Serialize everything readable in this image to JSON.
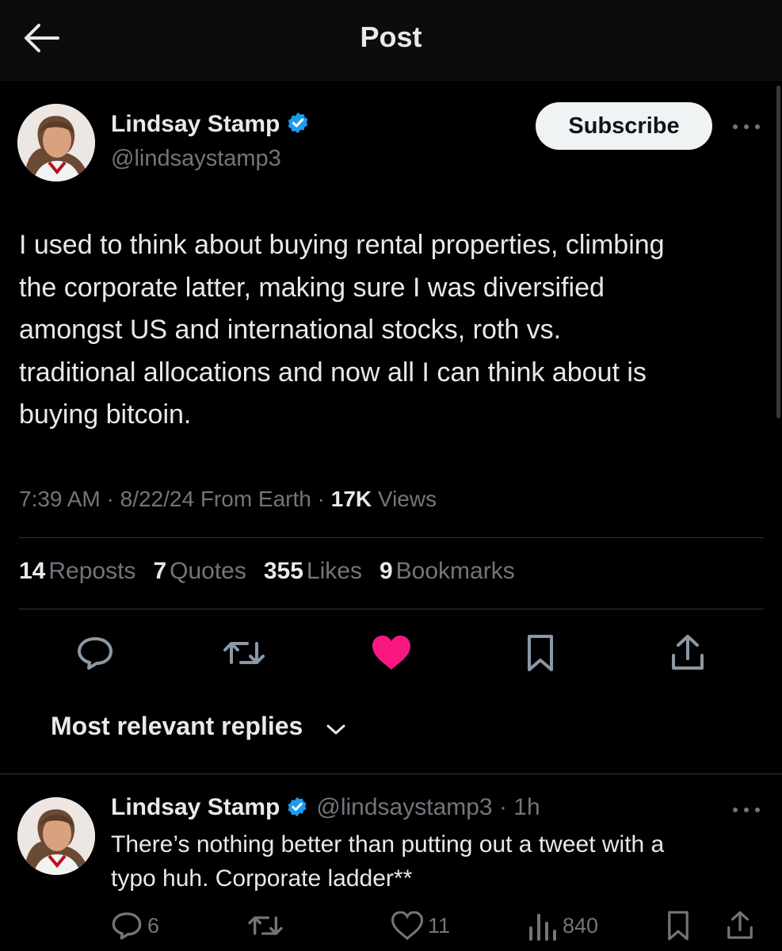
{
  "header": {
    "title": "Post"
  },
  "post": {
    "author": {
      "name": "Lindsay Stamp",
      "handle": "@lindsaystamp3"
    },
    "subscribe_label": "Subscribe",
    "text_lines": [
      "I used to think about buying rental properties, climbing",
      "the corporate latter, making sure I was diversified",
      "amongst US and international stocks, roth vs.",
      "traditional allocations and now all I can think about is",
      "buying bitcoin."
    ],
    "time": "7:39 AM",
    "date": "8/22/24",
    "location": "From Earth",
    "views_count": "17K",
    "views_label": "Views",
    "stats": {
      "reposts": {
        "count": "14",
        "label": "Reposts"
      },
      "quotes": {
        "count": "7",
        "label": "Quotes"
      },
      "likes": {
        "count": "355",
        "label": "Likes"
      },
      "bookmarks": {
        "count": "9",
        "label": "Bookmarks"
      }
    },
    "liked": true,
    "like_color": "#f91880"
  },
  "replies": {
    "sort_label": "Most relevant replies",
    "items": [
      {
        "author": {
          "name": "Lindsay Stamp",
          "handle": "@lindsaystamp3",
          "time": "1h"
        },
        "text_lines": [
          "There’s nothing better than putting out a tweet with a",
          "typo huh. Corporate ladder**"
        ],
        "reply_count": "6",
        "like_count": "11",
        "view_count": "840"
      }
    ]
  },
  "colors": {
    "background": "#000000",
    "text": "#e7e9ea",
    "muted": "#71767b",
    "verified": "#1d9bf0",
    "divider": "#2f3336"
  },
  "icons": [
    "back-arrow-icon",
    "verified-badge-icon",
    "more-icon",
    "reply-icon",
    "repost-icon",
    "heart-icon",
    "bookmark-icon",
    "share-icon",
    "chevron-down-icon",
    "views-icon"
  ]
}
